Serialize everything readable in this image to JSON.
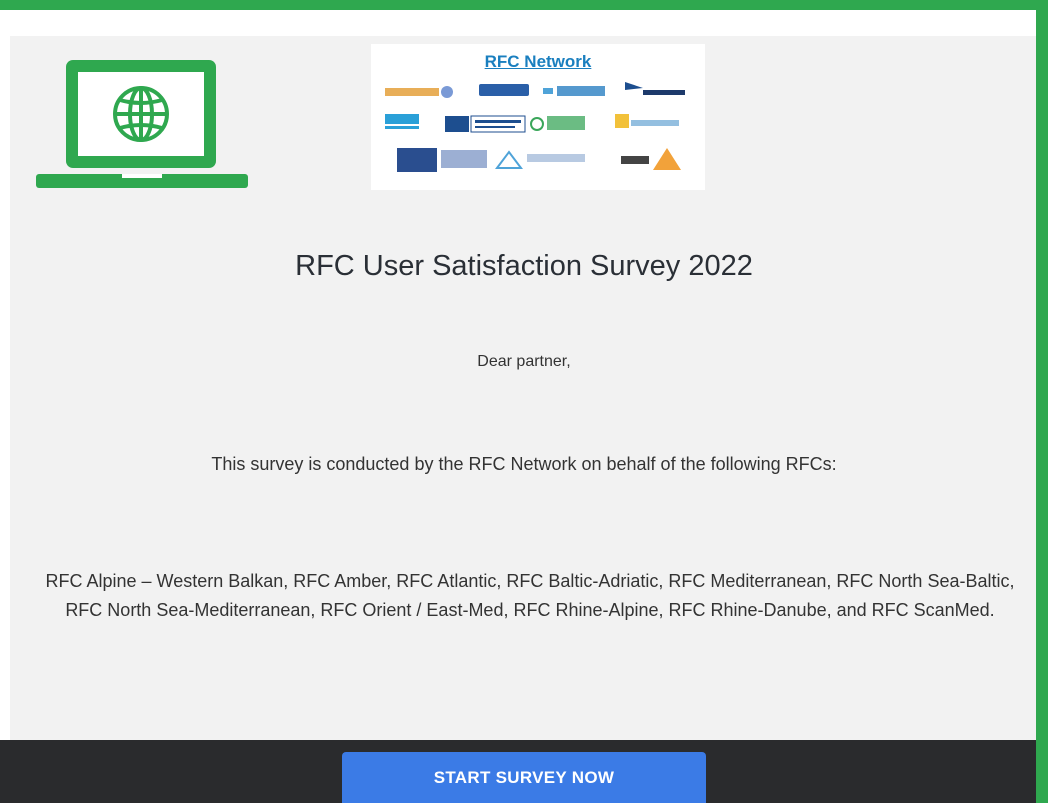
{
  "header": {
    "logo_title": "RFC Network",
    "laptop_icon": "globe-laptop-icon"
  },
  "main": {
    "title": "RFC User Satisfaction Survey 2022",
    "greeting": "Dear partner,",
    "intro": "This survey is conducted by the RFC Network on behalf of the following RFCs:",
    "rfc_list": "RFC Alpine – Western Balkan, RFC Amber, RFC Atlantic, RFC Baltic-Adriatic, RFC Mediterranean, RFC North Sea-Baltic, RFC North Sea-Mediterranean, RFC Orient / East-Med, RFC Rhine-Alpine, RFC Rhine-Danube, and RFC ScanMed."
  },
  "footer": {
    "start_button_label": "START SURVEY NOW"
  },
  "colors": {
    "accent_green": "#2fa84f",
    "button_blue": "#3b7be6",
    "footer_dark": "#2a2b2d"
  }
}
